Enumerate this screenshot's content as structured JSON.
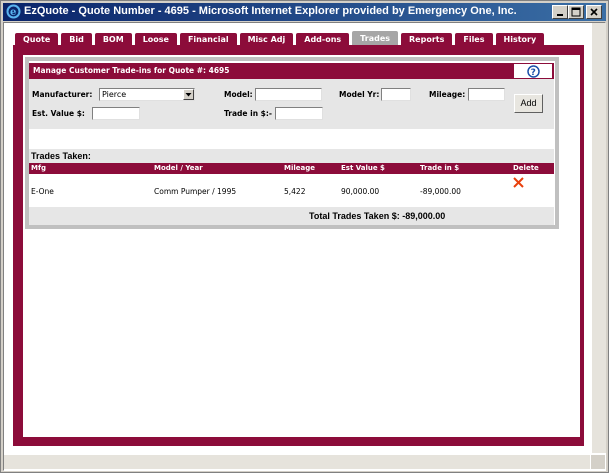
{
  "window": {
    "title": "EzQuote - Quote Number - 4695 - Microsoft Internet Explorer provided by Emergency One, Inc."
  },
  "tabs": [
    {
      "label": "Quote"
    },
    {
      "label": "Bid"
    },
    {
      "label": "BOM"
    },
    {
      "label": "Loose"
    },
    {
      "label": "Financial"
    },
    {
      "label": "Misc Adj"
    },
    {
      "label": "Add-ons"
    },
    {
      "label": "Trades",
      "active": true
    },
    {
      "label": "Reports"
    },
    {
      "label": "Files"
    },
    {
      "label": "History"
    }
  ],
  "manager": {
    "title": "Manage Customer Trade-ins for Quote #: 4695"
  },
  "form": {
    "manufacturer_label": "Manufacturer:",
    "manufacturer_value": "Pierce",
    "model_label": "Model:",
    "model_value": "",
    "model_yr_label": "Model Yr:",
    "model_yr_value": "",
    "mileage_label": "Mileage:",
    "mileage_value": "",
    "est_value_label": "Est. Value $:",
    "est_value_value": "",
    "trade_in_label": "Trade in $:-",
    "trade_in_value": "",
    "add_label": "Add"
  },
  "trades": {
    "title": "Trades Taken:",
    "columns": [
      "Mfg",
      "Model / Year",
      "Mileage",
      "Est Value $",
      "Trade in $",
      "Delete"
    ],
    "rows": [
      {
        "mfg": "E-One",
        "model_year": "Comm Pumper / 1995",
        "mileage": "5,422",
        "est_value": "90,000.00",
        "trade_in": "-89,000.00"
      }
    ],
    "total_label": "Total Trades Taken $:",
    "total_value": "-89,000.00"
  },
  "colors": {
    "brand": "#8c0c3a",
    "active_tab": "#a6a6a6",
    "delete_icon": "#e8400c",
    "help_icon": "#1c4fa8"
  },
  "icons": {
    "app": "ie-icon",
    "help": "help-icon",
    "delete": "delete-x-icon"
  }
}
